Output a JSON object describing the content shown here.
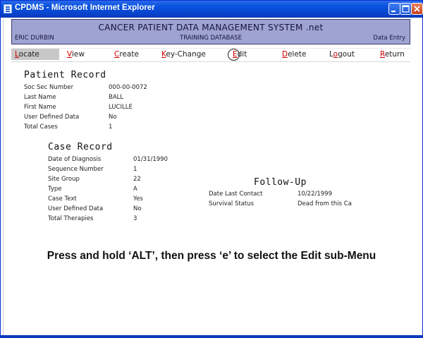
{
  "window": {
    "title": "CPDMS - Microsoft Internet Explorer"
  },
  "banner": {
    "system_title": "CANCER PATIENT DATA MANAGEMENT SYSTEM .net",
    "user": "ERIC DURBIN",
    "database": "TRAINING DATABASE",
    "mode": "Data Entry"
  },
  "menu": {
    "items": [
      {
        "hot": "L",
        "rest": "ocate",
        "active": true
      },
      {
        "hot": "V",
        "rest": "iew",
        "active": false
      },
      {
        "hot": "C",
        "rest": "reate",
        "active": false
      },
      {
        "hot": "K",
        "rest": "ey-Change",
        "active": false
      },
      {
        "hot": "E",
        "rest": "dit",
        "active": false,
        "circled": true
      },
      {
        "hot": "D",
        "rest": "elete",
        "active": false
      },
      {
        "hot": "L",
        "rest": "o",
        "suffix": "gout",
        "hot_pos": "middle",
        "active": false
      },
      {
        "hot": "R",
        "rest": "eturn",
        "active": false
      }
    ]
  },
  "patient_record": {
    "title": "Patient Record",
    "rows": [
      {
        "label": "Soc Sec Number",
        "value": "000-00-0072"
      },
      {
        "label": "Last Name",
        "value": "BALL"
      },
      {
        "label": "First Name",
        "value": "LUCILLE"
      },
      {
        "label": "User Defined Data",
        "value": "No"
      },
      {
        "label": "Total Cases",
        "value": "1"
      }
    ]
  },
  "case_record": {
    "title": "Case Record",
    "rows": [
      {
        "label": "Date of Diagnosis",
        "value": "01/31/1990"
      },
      {
        "label": "Sequence Number",
        "value": "1"
      },
      {
        "label": "Site Group",
        "value": "22"
      },
      {
        "label": "Type",
        "value": "A"
      },
      {
        "label": "Case Text",
        "value": "Yes"
      },
      {
        "label": "User Defined Data",
        "value": "No"
      },
      {
        "label": "Total Therapies",
        "value": "3"
      }
    ]
  },
  "follow_up": {
    "title": "Follow-Up",
    "rows": [
      {
        "label": "Date Last Contact",
        "value": "10/22/1999"
      },
      {
        "label": "Survival Status",
        "value": "Dead from this Ca"
      }
    ]
  },
  "instruction": "Press and hold ‘ALT’, then press ‘e’ to select the Edit sub-Menu"
}
